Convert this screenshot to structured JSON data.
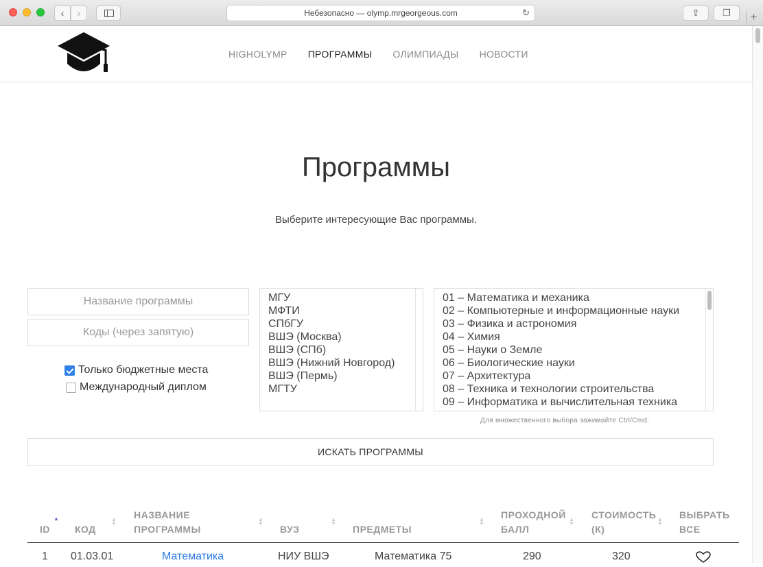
{
  "browser": {
    "url_text": "Небезопасно — olymp.mrgeorgeous.com"
  },
  "site": {
    "nav": [
      {
        "label": "HIGHOLYMP",
        "active": false
      },
      {
        "label": "ПРОГРАММЫ",
        "active": true
      },
      {
        "label": "ОЛИМПИАДЫ",
        "active": false
      },
      {
        "label": "НОВОСТИ",
        "active": false
      }
    ]
  },
  "page": {
    "title": "Программы",
    "subtitle": "Выберите интересующие Вас программы."
  },
  "filters": {
    "name_placeholder": "Название программы",
    "codes_placeholder": "Коды (через запятую)",
    "budget_only_label": "Только бюджетные места",
    "budget_only_checked": true,
    "international_label": "Международный диплом",
    "international_checked": false,
    "universities": [
      "МГУ",
      "МФТИ",
      "СПбГУ",
      "ВШЭ (Москва)",
      "ВШЭ (СПб)",
      "ВШЭ (Нижний Новгород)",
      "ВШЭ (Пермь)",
      "МГТУ"
    ],
    "directions": [
      "01 – Математика и механика",
      "02 – Компьютерные и информационные науки",
      "03 – Физика и астрономия",
      "04 – Химия",
      "05 – Науки о Земле",
      "06 – Биологические науки",
      "07 – Архитектура",
      "08 – Техника и технологии строительства",
      "09 – Информатика и вычислительная техника"
    ],
    "multi_select_hint": "Для множественного выбора зажимайте Ctrl/Cmd.",
    "search_button": "ИСКАТЬ ПРОГРАММЫ"
  },
  "table": {
    "headers": {
      "id": "ID",
      "code": "КОД",
      "name_1": "НАЗВАНИЕ",
      "name_2": "ПРОГРАММЫ",
      "uni": "ВУЗ",
      "subjects": "ПРЕДМЕТЫ",
      "score_1": "ПРОХОДНОЙ",
      "score_2": "БАЛЛ",
      "cost_1": "СТОИМОСТЬ",
      "cost_2": "(К)",
      "select_1": "ВЫБРАТЬ",
      "select_2": "ВСЕ"
    },
    "rows": [
      {
        "id": "1",
        "code": "01.03.01",
        "name": "Математика",
        "uni": "НИУ ВШЭ",
        "subjects": "Математика 75",
        "score": "290",
        "cost": "320"
      }
    ]
  }
}
